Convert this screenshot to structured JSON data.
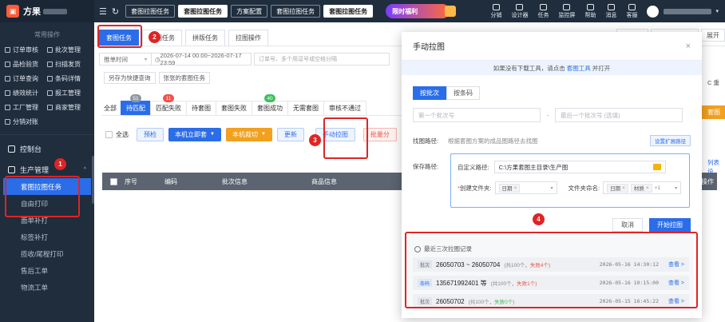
{
  "app": {
    "logo_char": "▣",
    "name": "方果"
  },
  "sidebar": {
    "section_title": "常用操作",
    "quick_items": [
      "订单审核",
      "批次管理",
      "品检验货",
      "扫描发货",
      "订单查询",
      "条码详情",
      "绩效统计",
      "报工管理",
      "工厂管理",
      "商家管理",
      "分销对账"
    ],
    "menu": [
      {
        "label": "控制台"
      },
      {
        "label": "生产管理",
        "chevron": "^"
      }
    ],
    "submenu": [
      "套图拉图任务",
      "自由打印",
      "面单补打",
      "标签补打",
      "揽收/尾程打印",
      "售后工单",
      "物流工单"
    ]
  },
  "topbar": {
    "menu_icon": "☰",
    "refresh_icon": "↻",
    "tabs": [
      {
        "label": "套图拉图任务",
        "close": ""
      },
      {
        "label": "套图拉图任务",
        "close": ""
      },
      {
        "label": "方案配置",
        "close": ""
      },
      {
        "label": "套图拉图任务",
        "close": ""
      },
      {
        "label": "套图拉图任务",
        "close": ""
      }
    ],
    "promo": "限时福利",
    "tools": [
      "分销",
      "设计器",
      "任务",
      "监控屏",
      "帮助",
      "消息",
      "客服"
    ]
  },
  "main": {
    "subtabs": [
      "套图任务",
      "套图任务",
      "拼版任务",
      "拉图操作"
    ],
    "right_buttons": [
      "",
      "",
      "展开"
    ],
    "filter": {
      "time_type": "推单时间",
      "date_range": "2026-07-14 00:00~2026-07-17 23:59",
      "order_placeholder": "订单号、多个用逗号或空格分隔"
    },
    "row2_buttons": [
      "另存为快捷查询",
      "张张的套图任务"
    ],
    "status_tabs": [
      {
        "label": "全部",
        "badge": "",
        "badge_color": ""
      },
      {
        "label": "待匹配",
        "badge": "51",
        "badge_color": "gray"
      },
      {
        "label": "匹配失败",
        "badge": "11",
        "badge_color": "red"
      },
      {
        "label": "待套图",
        "badge": "",
        "badge_color": ""
      },
      {
        "label": "套图失败",
        "badge": "",
        "badge_color": ""
      },
      {
        "label": "套图成功",
        "badge": "40",
        "badge_color": "green"
      },
      {
        "label": "无需套图",
        "badge": "",
        "badge_color": ""
      },
      {
        "label": "审核不通过",
        "badge": "",
        "badge_color": ""
      }
    ],
    "actions": {
      "select_all": "全选",
      "precheck": "预检",
      "print_now": "本机立即套",
      "local_cut": "本机裁切",
      "update": "更新",
      "manual_pull": "手动拉图",
      "batch_split": "批量分"
    },
    "table_headers": [
      "序号",
      "编码",
      "批次信息",
      "商品信息",
      "操作"
    ],
    "right_peek": {
      "refresh": "C 重",
      "blue": "套图",
      "col": "列表设"
    }
  },
  "modal": {
    "title": "手动拉图",
    "close": "×",
    "notice_prefix": "如果没有下载工具，请点击",
    "notice_link": "套图工具",
    "notice_suffix": "并打开",
    "segments": [
      "按批次",
      "按条码"
    ],
    "first_placeholder": "第一个批次号",
    "last_placeholder": "最后一个批次号 (选填)",
    "dash": "-",
    "find_path_label": "找图路径:",
    "find_path_hint": "根据套图方案的成品图路径去找图",
    "ext_button": "设置扩展路径",
    "save_path_label": "保存路径:",
    "custom_path_label": "自定义路径:",
    "custom_path_value": "C:\\方果套图主目录\\生产图",
    "create_folder_label": "创建文件夹:",
    "create_folder_tags": [
      "日期"
    ],
    "folder_name_label": "文件夹命名:",
    "folder_name_tags": [
      "日期",
      "材质"
    ],
    "folder_name_more": "+1",
    "cancel": "取消",
    "start": "开始拉图",
    "records_title": "最近三次拉图记录",
    "records": [
      {
        "type": "批次",
        "main": "26050703 ~ 26050704",
        "count": "(共100个，",
        "status": "失败4个)",
        "status_kind": "fail",
        "time": "2026-05-16 14:30:12",
        "view": "查看 >"
      },
      {
        "type": "条码",
        "main": "135671992401 等",
        "count": "(共100个，",
        "status": "失败1个)",
        "status_kind": "fail",
        "time": "2026-05-16 10:15:00",
        "view": "查看 >"
      },
      {
        "type": "批次",
        "main": "26050702",
        "count": "(共100个，",
        "status": "失败0个)",
        "status_kind": "ok",
        "time": "2026-05-15 16:45:22",
        "view": "查看 >"
      }
    ]
  },
  "annotations": [
    "1",
    "2",
    "3",
    "4"
  ]
}
